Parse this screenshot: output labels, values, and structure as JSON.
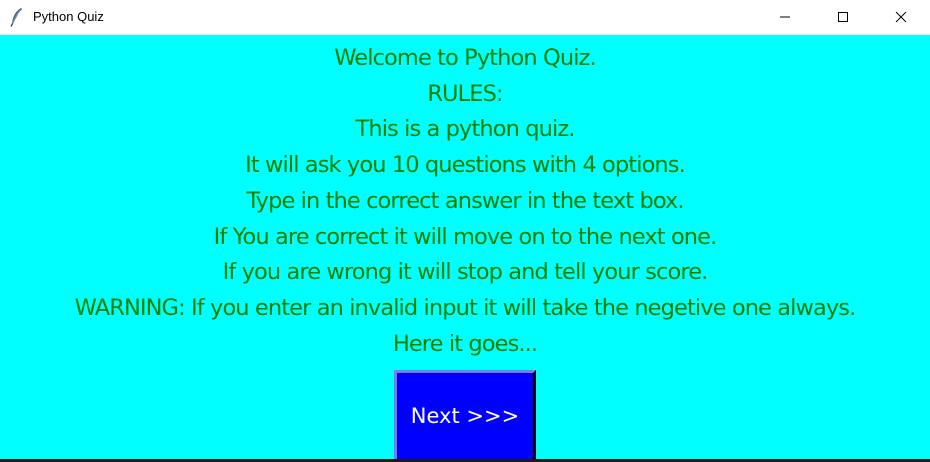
{
  "window": {
    "title": "Python Quiz",
    "icon": "feather-icon",
    "controls": [
      "minimize-icon",
      "maximize-icon",
      "close-icon"
    ]
  },
  "colors": {
    "background": "#00ffff",
    "text": "#008000",
    "button_bg": "#0000ff",
    "button_text": "#ffffff"
  },
  "rules": {
    "lines": [
      "Welcome to Python Quiz.",
      "RULES:",
      "This is a python quiz.",
      "It will ask you 10 questions with 4 options.",
      "Type in the correct answer in the text box.",
      "If You are correct it will move on to the next one.",
      "If you are wrong it will stop and tell your score.",
      "WARNING: If you enter an invalid input it will take the negetive one always.",
      "Here it goes..."
    ]
  },
  "next_button": {
    "label": "Next >>>"
  }
}
